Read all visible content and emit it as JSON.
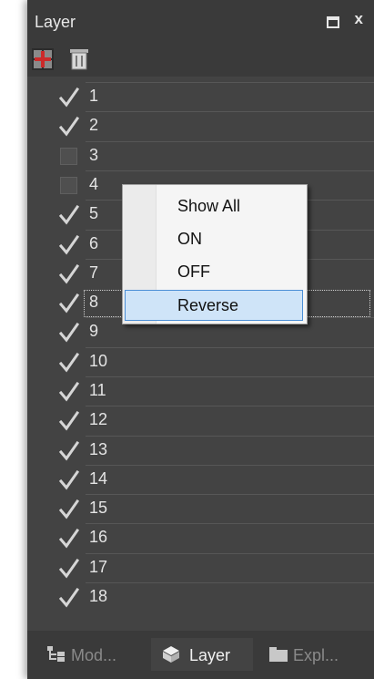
{
  "panel": {
    "title": "Layer",
    "restore_icon": "restore-window-icon",
    "close_label": "x"
  },
  "toolbar": {
    "add_icon": "add-layer-icon",
    "delete_icon": "delete-layer-icon"
  },
  "layers": [
    {
      "label": "1",
      "checked": true
    },
    {
      "label": "2",
      "checked": true
    },
    {
      "label": "3",
      "checked": false
    },
    {
      "label": "4",
      "checked": false
    },
    {
      "label": "5",
      "checked": true
    },
    {
      "label": "6",
      "checked": true
    },
    {
      "label": "7",
      "checked": true
    },
    {
      "label": "8",
      "checked": true,
      "selected": true
    },
    {
      "label": "9",
      "checked": true
    },
    {
      "label": "10",
      "checked": true
    },
    {
      "label": "11",
      "checked": true
    },
    {
      "label": "12",
      "checked": true
    },
    {
      "label": "13",
      "checked": true
    },
    {
      "label": "14",
      "checked": true
    },
    {
      "label": "15",
      "checked": true
    },
    {
      "label": "16",
      "checked": true
    },
    {
      "label": "17",
      "checked": true
    },
    {
      "label": "18",
      "checked": true
    }
  ],
  "context_menu": {
    "items": [
      {
        "label": "Show All"
      },
      {
        "label": "ON"
      },
      {
        "label": "OFF"
      },
      {
        "label": "Reverse",
        "highlighted": true
      }
    ]
  },
  "bottom_tabs": [
    {
      "label": "Mod...",
      "icon": "model-tree-icon",
      "active": false
    },
    {
      "label": "Layer",
      "icon": "layer-cube-icon",
      "active": true
    },
    {
      "label": "Expl...",
      "icon": "folder-icon",
      "active": false
    }
  ],
  "colors": {
    "panel_bg": "#434343",
    "menu_highlight": "#cfe4f8",
    "menu_highlight_border": "#4c8fd6"
  }
}
